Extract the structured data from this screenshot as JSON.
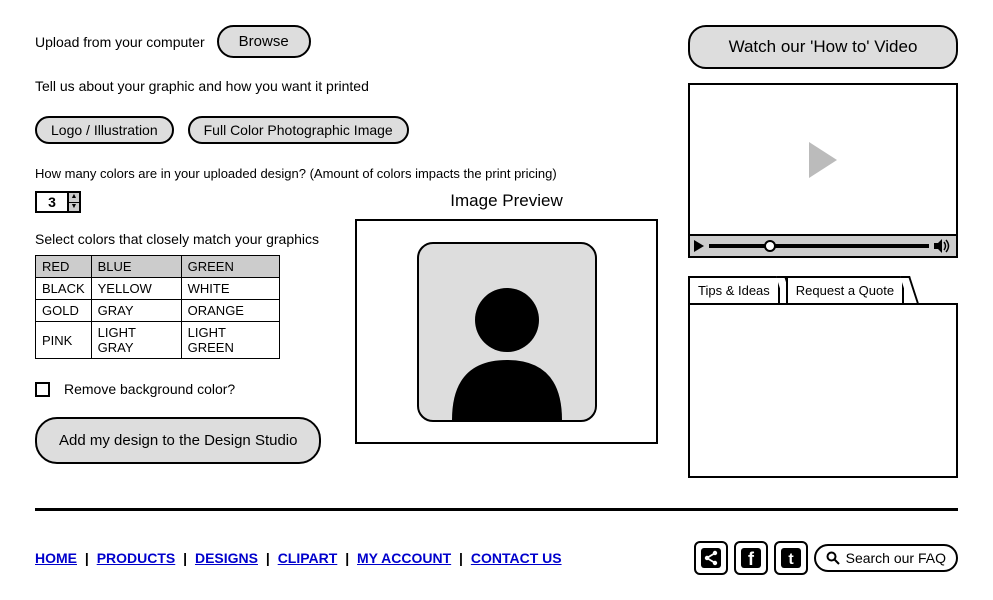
{
  "upload": {
    "label": "Upload from your computer",
    "browse": "Browse"
  },
  "tell": "Tell us about your graphic and how you want it printed",
  "types": {
    "logo": "Logo / Illustration",
    "photo": "Full Color Photographic Image"
  },
  "colorsQuestion": "How many colors are in your uploaded design? (Amount of colors impacts the print pricing)",
  "colorCount": "3",
  "selectColorsLabel": "Select colors that closely match your graphics",
  "colorTable": [
    [
      "RED",
      "BLUE",
      "GREEN"
    ],
    [
      "BLACK",
      "YELLOW",
      "WHITE"
    ],
    [
      "GOLD",
      "GRAY",
      "ORANGE"
    ],
    [
      "PINK",
      "LIGHT GRAY",
      "LIGHT GREEN"
    ]
  ],
  "removeBg": "Remove background color?",
  "addDesign": "Add my design to the Design Studio",
  "previewTitle": "Image Preview",
  "watchVideo": "Watch our 'How to' Video",
  "tabs": {
    "tips": "Tips & Ideas",
    "quote": "Request a Quote"
  },
  "footer": {
    "home": "HOME",
    "products": "PRODUCTS",
    "designs": "DESIGNS",
    "clipart": "CLIPART",
    "account": "MY ACCOUNT",
    "contact": "CONTACT US",
    "search": "Search our FAQ"
  }
}
